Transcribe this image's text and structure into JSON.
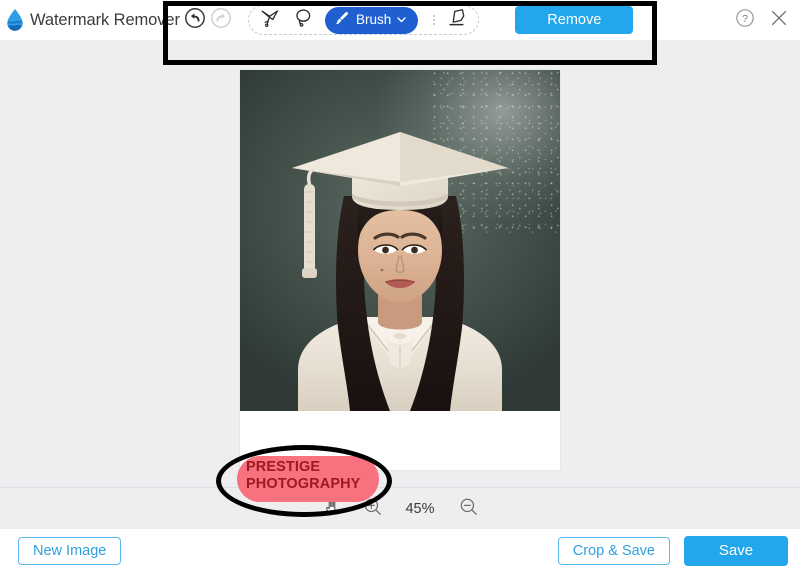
{
  "app": {
    "title": "Watermark Remover",
    "logo_icon": "water-drop-logo"
  },
  "toolbar": {
    "undo_icon": "undo-arrow-icon",
    "redo_icon": "redo-arrow-icon",
    "polygon_lasso_icon": "polygon-lasso-icon",
    "freehand_lasso_icon": "freehand-lasso-icon",
    "brush_label": "Brush",
    "brush_icon": "paintbrush-icon",
    "brush_dropdown_icon": "chevron-down-icon",
    "brush_active_color": "#1f5fd0",
    "eraser_icon": "eraser-icon",
    "remove_label": "Remove",
    "remove_color": "#22a7ec",
    "help_icon": "question-circle-icon",
    "close_icon": "close-x-icon"
  },
  "annotations": {
    "toolbar_highlight": "black-rectangle-annotation",
    "watermark_highlight": "black-ellipse-annotation"
  },
  "canvas": {
    "image_alt": "graduation-portrait-photo",
    "watermark_line1": "PRESTIGE",
    "watermark_line2": "PHOTOGRAPHY",
    "watermark_text_color": "#9c1b20",
    "brush_selection_color": "#f8717f"
  },
  "zoombar": {
    "pan_icon": "hand-pan-icon",
    "zoom_in_icon": "zoom-in-icon",
    "zoom_out_icon": "zoom-out-icon",
    "zoom_level": "45%"
  },
  "bottombar": {
    "new_image_label": "New Image",
    "crop_save_label": "Crop & Save",
    "save_label": "Save",
    "accent_color": "#22a7ec"
  }
}
